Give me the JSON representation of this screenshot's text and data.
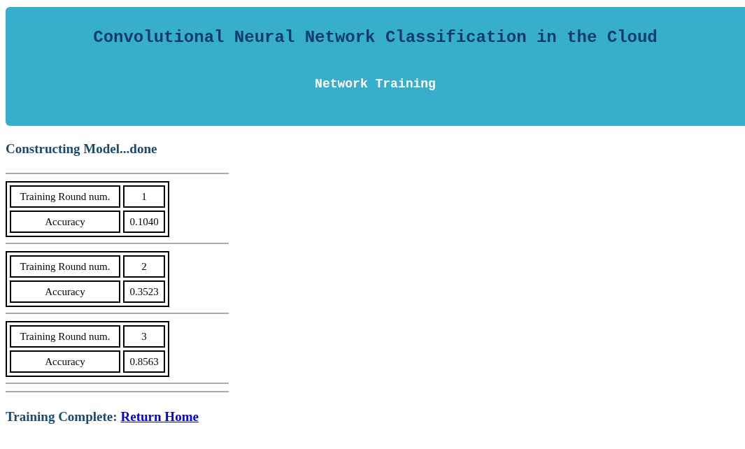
{
  "header": {
    "title": "Convolutional Neural Network Classification in the Cloud",
    "subtitle": "Network Training"
  },
  "status": "Constructing Model...done",
  "rounds": [
    {
      "label": "Training Round num.",
      "round": "1",
      "metric": "Accuracy",
      "value": "0.1040"
    },
    {
      "label": "Training Round num.",
      "round": "2",
      "metric": "Accuracy",
      "value": "0.3523"
    },
    {
      "label": "Training Round num.",
      "round": "3",
      "metric": "Accuracy",
      "value": "0.8563"
    }
  ],
  "footer": {
    "text": "Training Complete:",
    "link": "Return Home"
  }
}
